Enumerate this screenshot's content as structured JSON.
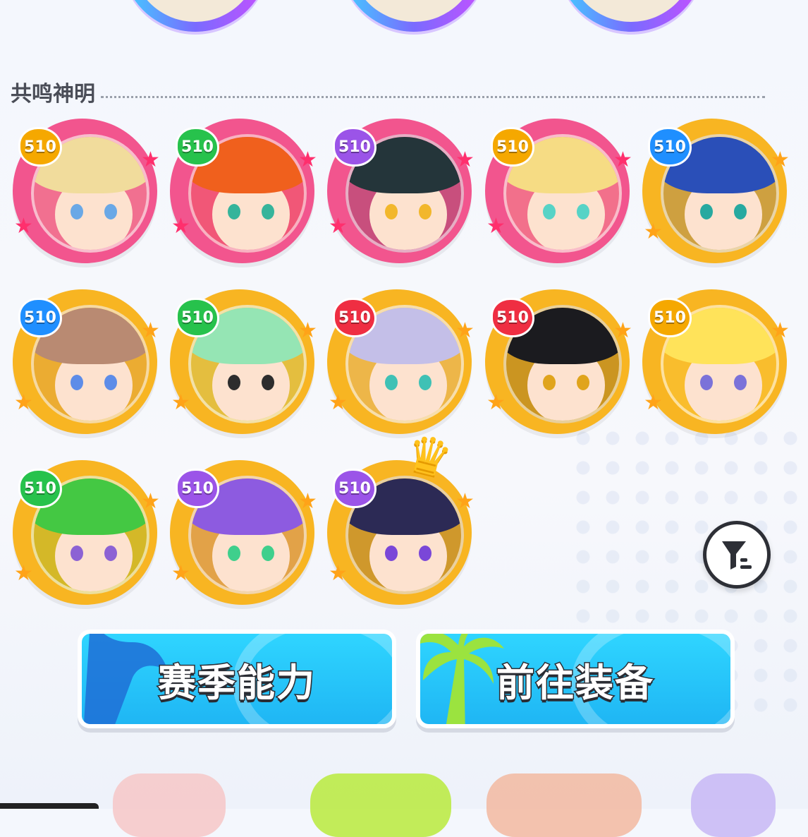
{
  "section": {
    "title": "共鸣神明"
  },
  "cards": [
    {
      "level": "510",
      "level_color": "c-gold",
      "frame": "pink",
      "hair": "#f1dc9c",
      "eye": "#6aa8e6"
    },
    {
      "level": "510",
      "level_color": "c-green",
      "frame": "pink",
      "hair": "#f0601d",
      "eye": "#36b49b"
    },
    {
      "level": "510",
      "level_color": "c-purple",
      "frame": "pink",
      "hair": "#24353a",
      "eye": "#f2b72c"
    },
    {
      "level": "510",
      "level_color": "c-gold",
      "frame": "pink",
      "hair": "#f6dc84",
      "eye": "#57d3c6"
    },
    {
      "level": "510",
      "level_color": "c-blue",
      "frame": "gold",
      "hair": "#2a4fb8",
      "eye": "#27a9a0"
    },
    {
      "level": "510",
      "level_color": "c-blue",
      "frame": "gold",
      "hair": "#b98a72",
      "eye": "#5d8ce8"
    },
    {
      "level": "510",
      "level_color": "c-green",
      "frame": "gold",
      "hair": "#95e5b4",
      "eye": "#2d2d2d"
    },
    {
      "level": "510",
      "level_color": "c-red",
      "frame": "gold",
      "hair": "#c4bfe8",
      "eye": "#3fc1b5"
    },
    {
      "level": "510",
      "level_color": "c-red",
      "frame": "gold",
      "hair": "#1b1b1f",
      "eye": "#e0a41c"
    },
    {
      "level": "510",
      "level_color": "c-gold",
      "frame": "gold",
      "hair": "#ffe35a",
      "eye": "#7b72d9"
    },
    {
      "level": "510",
      "level_color": "c-green",
      "frame": "gold",
      "hair": "#44c843",
      "eye": "#8c62d4"
    },
    {
      "level": "510",
      "level_color": "c-purple",
      "frame": "gold",
      "hair": "#8d5be0",
      "eye": "#3fcf8c"
    },
    {
      "level": "510",
      "level_color": "c-purple",
      "frame": "gold",
      "hair": "#2c2a55",
      "eye": "#7a47d8"
    }
  ],
  "buttons": {
    "season_ability": "赛季能力",
    "go_equipment": "前往装备"
  },
  "icons": {
    "filter": "filter-icon",
    "crown": "crown-icon",
    "star": "star-icon"
  }
}
